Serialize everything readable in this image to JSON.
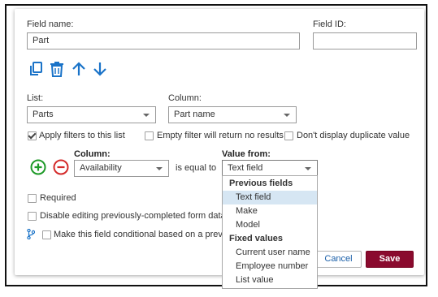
{
  "field_name": {
    "label": "Field name:",
    "value": "Part"
  },
  "field_id": {
    "label": "Field ID:",
    "value": ""
  },
  "toolbar_icons": [
    "copy-icon",
    "trash-icon",
    "arrow-up-icon",
    "arrow-down-icon"
  ],
  "list": {
    "label": "List:",
    "value": "Parts"
  },
  "column": {
    "label": "Column:",
    "value": "Part name"
  },
  "options": {
    "apply_filters": {
      "label": "Apply filters to this list",
      "checked": true
    },
    "empty_filter": {
      "label": "Empty filter will return no results",
      "checked": false
    },
    "no_duplicates": {
      "label": "Don't display duplicate value",
      "checked": false
    }
  },
  "filter": {
    "column_label": "Column:",
    "column_value": "Availability",
    "operator": "is equal to",
    "value_label": "Value from:",
    "value_input": "Text field"
  },
  "required": {
    "label": "Required",
    "checked": false
  },
  "disable_editing": {
    "label": "Disable editing previously-completed form data",
    "checked": false
  },
  "conditional": {
    "label": "Make this field conditional based on a previou",
    "checked": false
  },
  "dropdown": {
    "groups": [
      {
        "header": "Previous fields",
        "items": [
          "Text field",
          "Make",
          "Model"
        ]
      },
      {
        "header": "Fixed values",
        "items": [
          "Current user name",
          "Employee number",
          "List value"
        ]
      }
    ],
    "highlighted": "Text field"
  },
  "buttons": {
    "cancel": "Cancel",
    "save": "Save"
  },
  "colors": {
    "icon_blue": "#1a73c8",
    "add_green": "#1e9a28",
    "remove_red": "#d42a2a",
    "save_bg": "#8a0a2e",
    "highlight": "#d6e6f3"
  }
}
